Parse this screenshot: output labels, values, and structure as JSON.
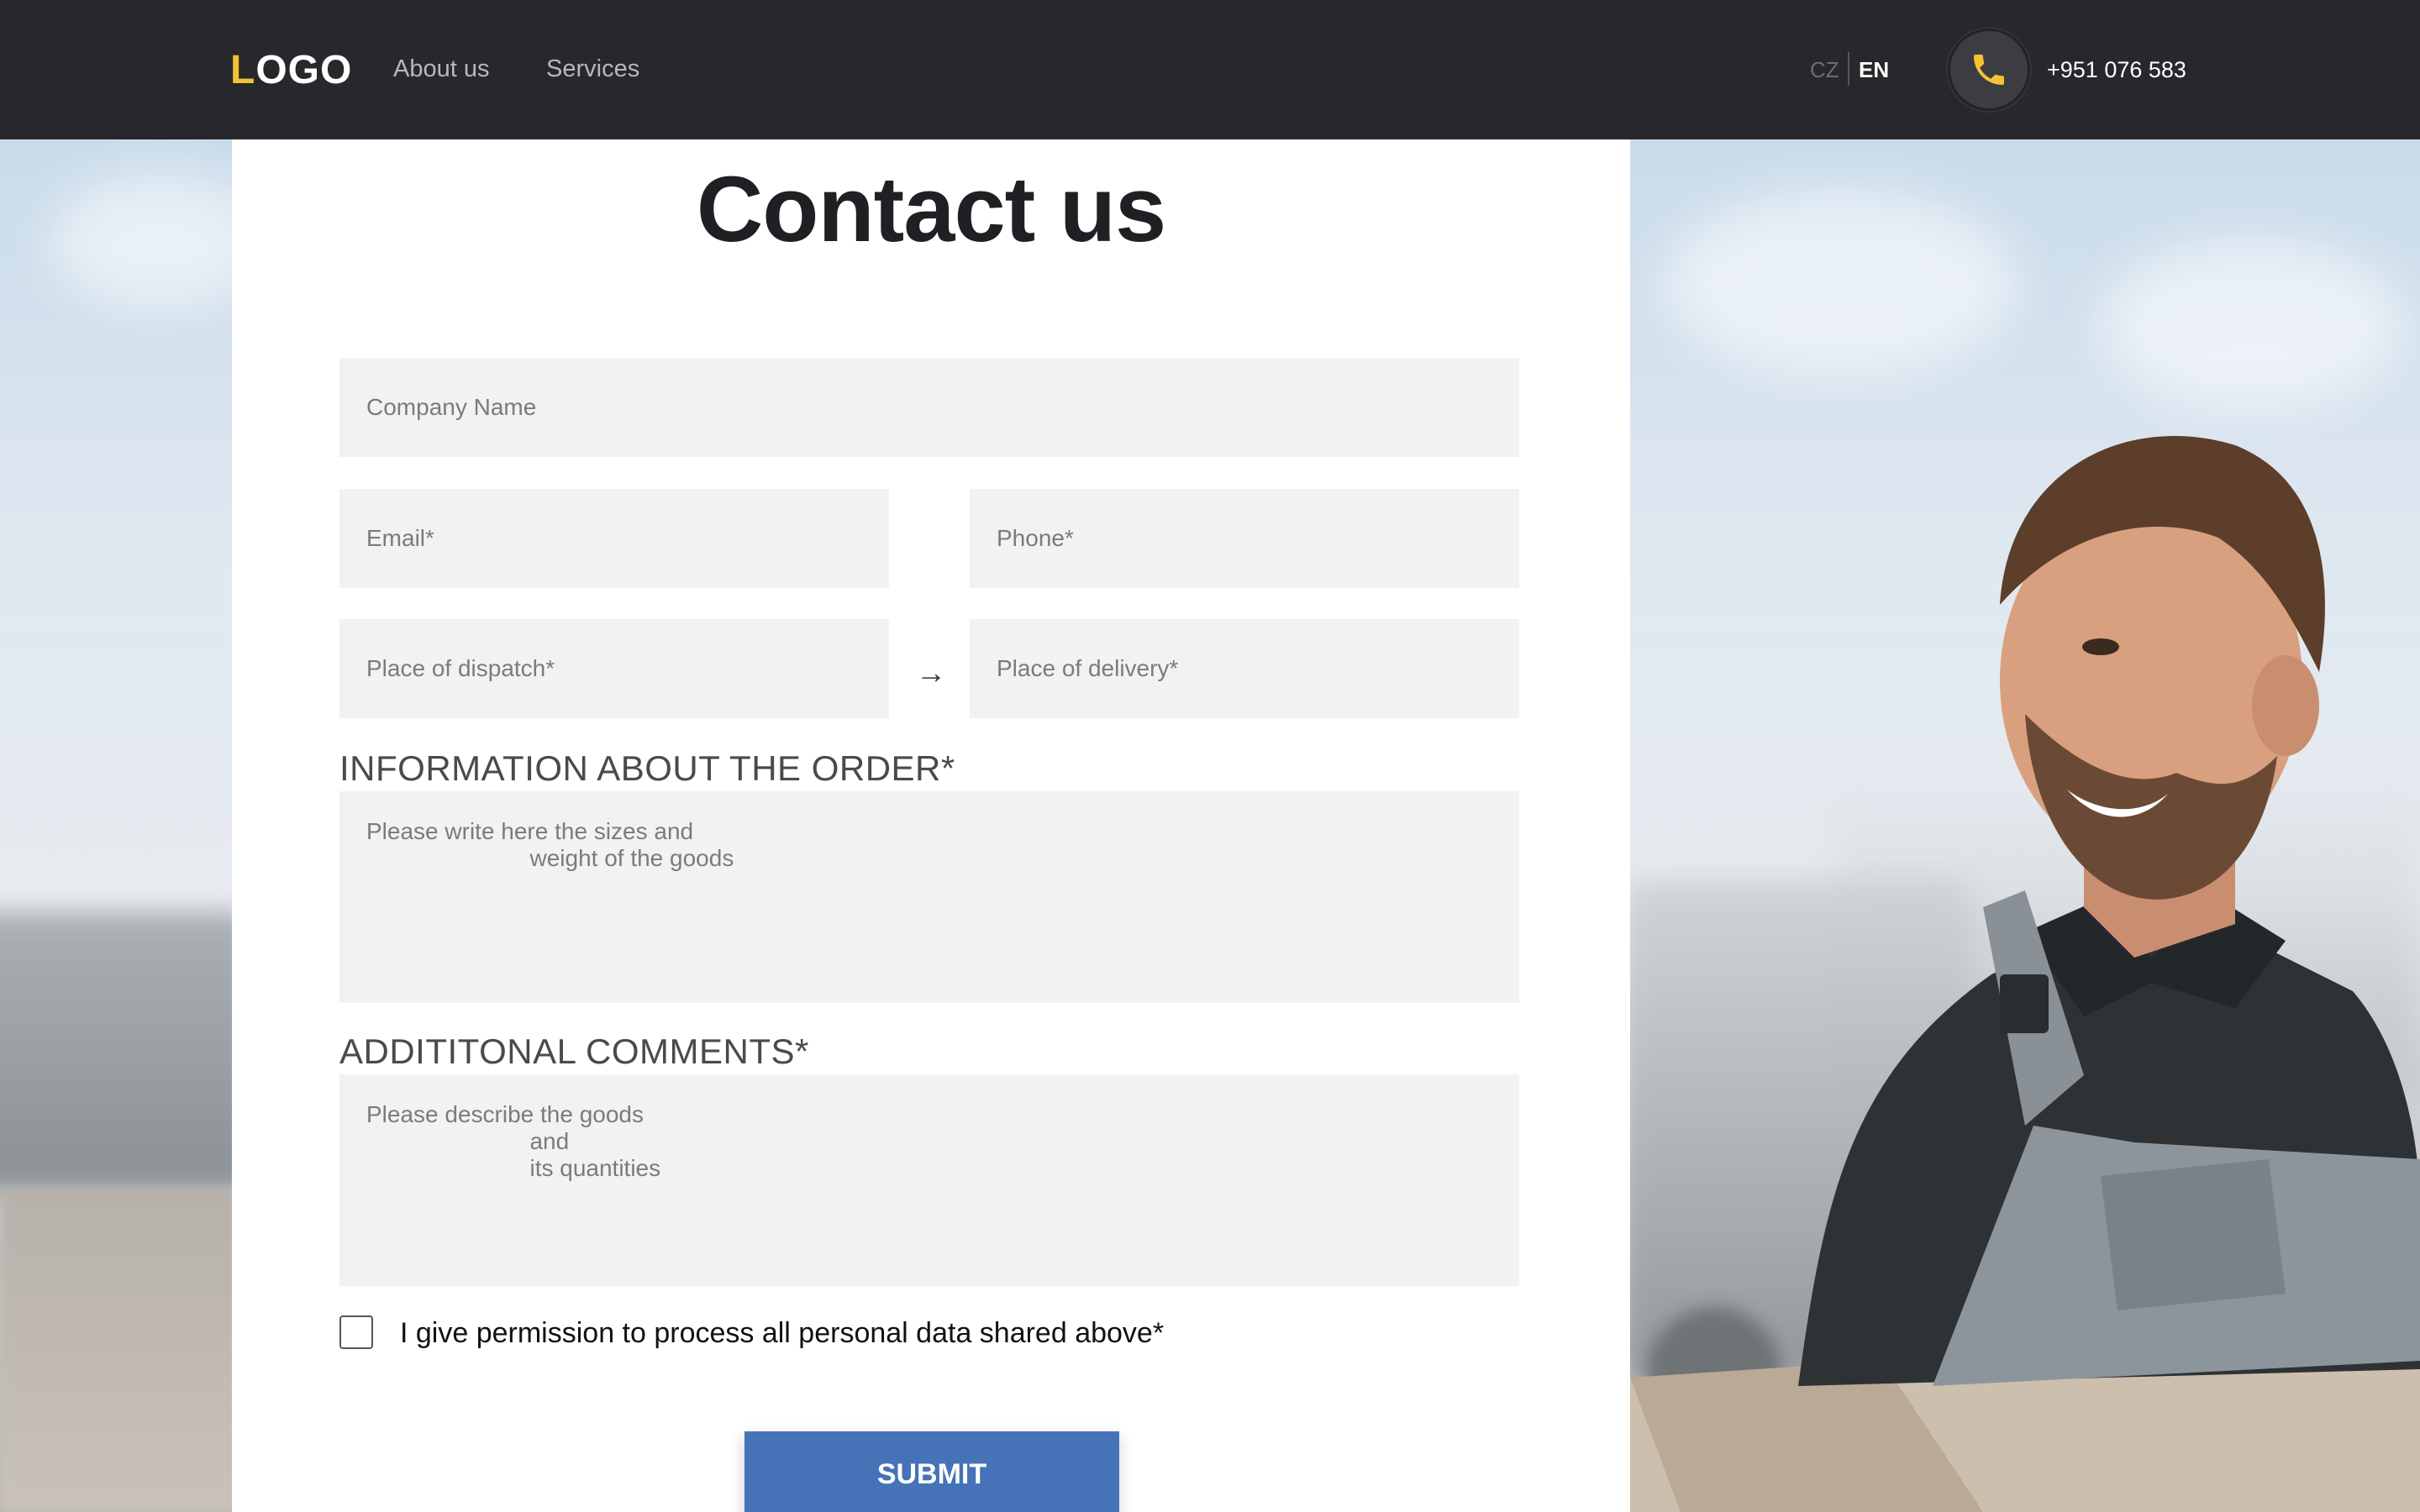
{
  "header": {
    "logo_first": "L",
    "logo_rest": "OGO",
    "nav": [
      "About us",
      "Services"
    ],
    "lang": {
      "cz": "CZ",
      "en": "EN",
      "active": "EN"
    },
    "phone_icon": "phone-icon",
    "phone": "+951 076 583"
  },
  "main": {
    "title": "Contact us",
    "fields": {
      "company": "Company Name",
      "email": "Email*",
      "phone": "Phone*",
      "dispatch": "Place of dispatch*",
      "delivery": "Place of delivery*"
    },
    "arrow": "→",
    "order_label": "INFORMATION ABOUT THE ORDER*",
    "order_placeholder": "Please write here the sizes and\n                         weight of the goods",
    "comments_label": "ADDITITONAL COMMENTS*",
    "comments_placeholder": "Please describe the goods\n                         and\n                         its quantities",
    "consent": "I give permission to process all personal data shared above*",
    "submit": "SUBMIT"
  },
  "colors": {
    "header_bg": "#27282b",
    "accent": "#f4c235",
    "button": "#4672b8",
    "field_bg": "#f2f2f2"
  }
}
